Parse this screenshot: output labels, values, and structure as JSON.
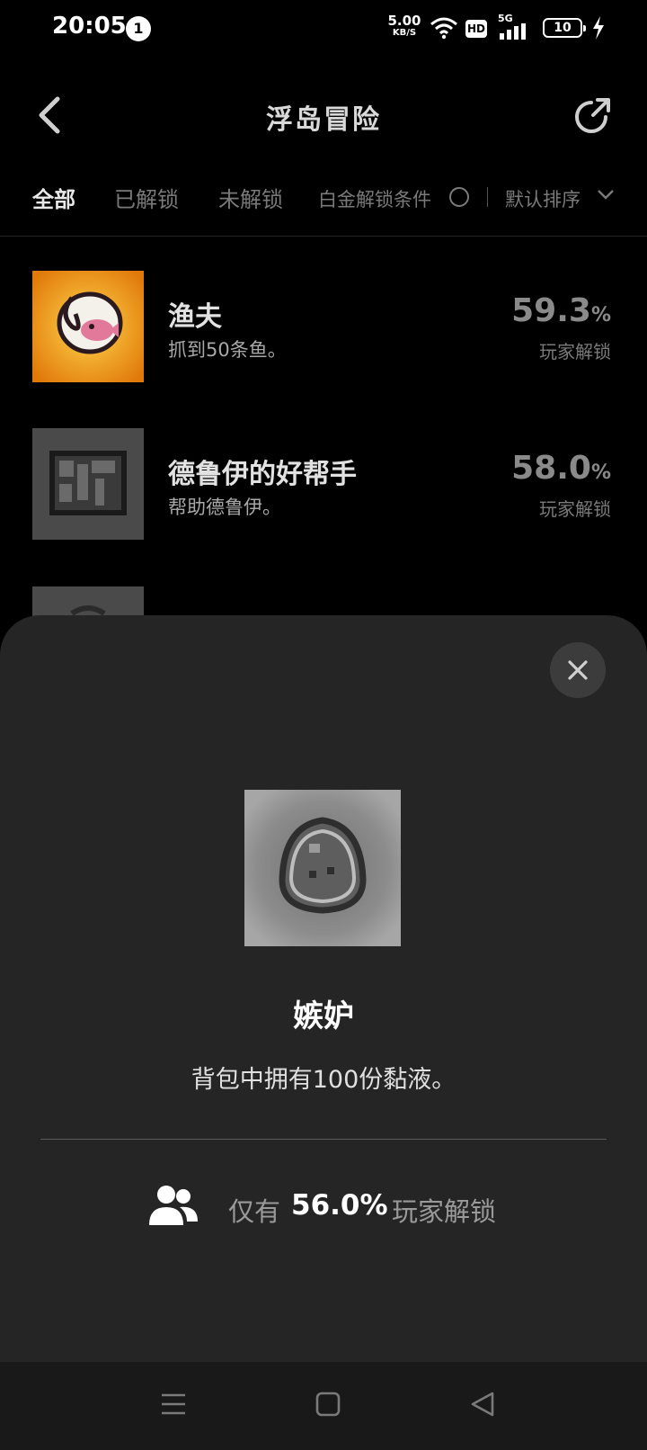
{
  "status_bar": {
    "time": "20:05",
    "notification_count": "1",
    "net_speed_value": "5.00",
    "net_speed_unit": "KB/S",
    "hd_label": "HD",
    "network_type": "5G",
    "battery": "10"
  },
  "header": {
    "title": "浮岛冒险"
  },
  "tabs": {
    "all": "全部",
    "unlocked": "已解锁",
    "locked": "未解锁",
    "platinum_condition": "白金解锁条件",
    "sort": "默认排序"
  },
  "achievements": [
    {
      "title": "渔夫",
      "desc": "抓到50条鱼。",
      "pct": "59.3",
      "pct_sign": "%",
      "sub": "玩家解锁"
    },
    {
      "title": "德鲁伊的好帮手",
      "desc": "帮助德鲁伊。",
      "pct": "58.0",
      "pct_sign": "%",
      "sub": "玩家解锁"
    }
  ],
  "detail": {
    "name": "嫉妒",
    "desc": "背包中拥有100份黏液。",
    "stat_prefix": "仅有",
    "stat_percent": "56.0%",
    "stat_suffix": "玩家解锁"
  },
  "colors": {
    "background": "#000000",
    "sheet": "#252525",
    "fisher_badge_bg": "#f0a020"
  }
}
